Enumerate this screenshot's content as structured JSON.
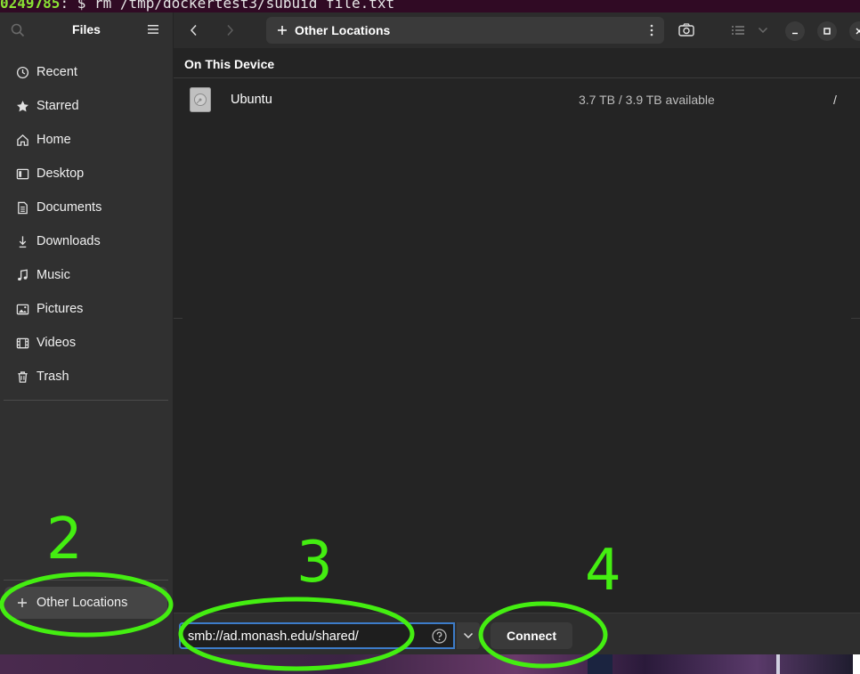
{
  "terminal": {
    "host_text": "0249785",
    "command_text": ": $ rm /tmp/dockertest3/subuid file.txt"
  },
  "sidebar": {
    "title": "Files",
    "items": [
      {
        "label": "Recent",
        "icon": "clock-icon"
      },
      {
        "label": "Starred",
        "icon": "star-icon"
      },
      {
        "label": "Home",
        "icon": "home-icon"
      },
      {
        "label": "Desktop",
        "icon": "desktop-icon"
      },
      {
        "label": "Documents",
        "icon": "document-icon"
      },
      {
        "label": "Downloads",
        "icon": "download-icon"
      },
      {
        "label": "Music",
        "icon": "music-icon"
      },
      {
        "label": "Pictures",
        "icon": "picture-icon"
      },
      {
        "label": "Videos",
        "icon": "video-icon"
      },
      {
        "label": "Trash",
        "icon": "trash-icon"
      }
    ],
    "other_locations": "Other Locations"
  },
  "toolbar": {
    "path_label": "Other Locations"
  },
  "main": {
    "section_title": "On This Device",
    "device": {
      "name": "Ubuntu",
      "space": "3.7 TB / 3.9 TB available",
      "mount": "/"
    }
  },
  "connect_bar": {
    "server_address": "smb://ad.monash.edu/shared/",
    "connect_label": "Connect"
  },
  "annotations": {
    "n2": "2",
    "n3": "3",
    "n4": "4",
    "color": "#44ee11"
  }
}
